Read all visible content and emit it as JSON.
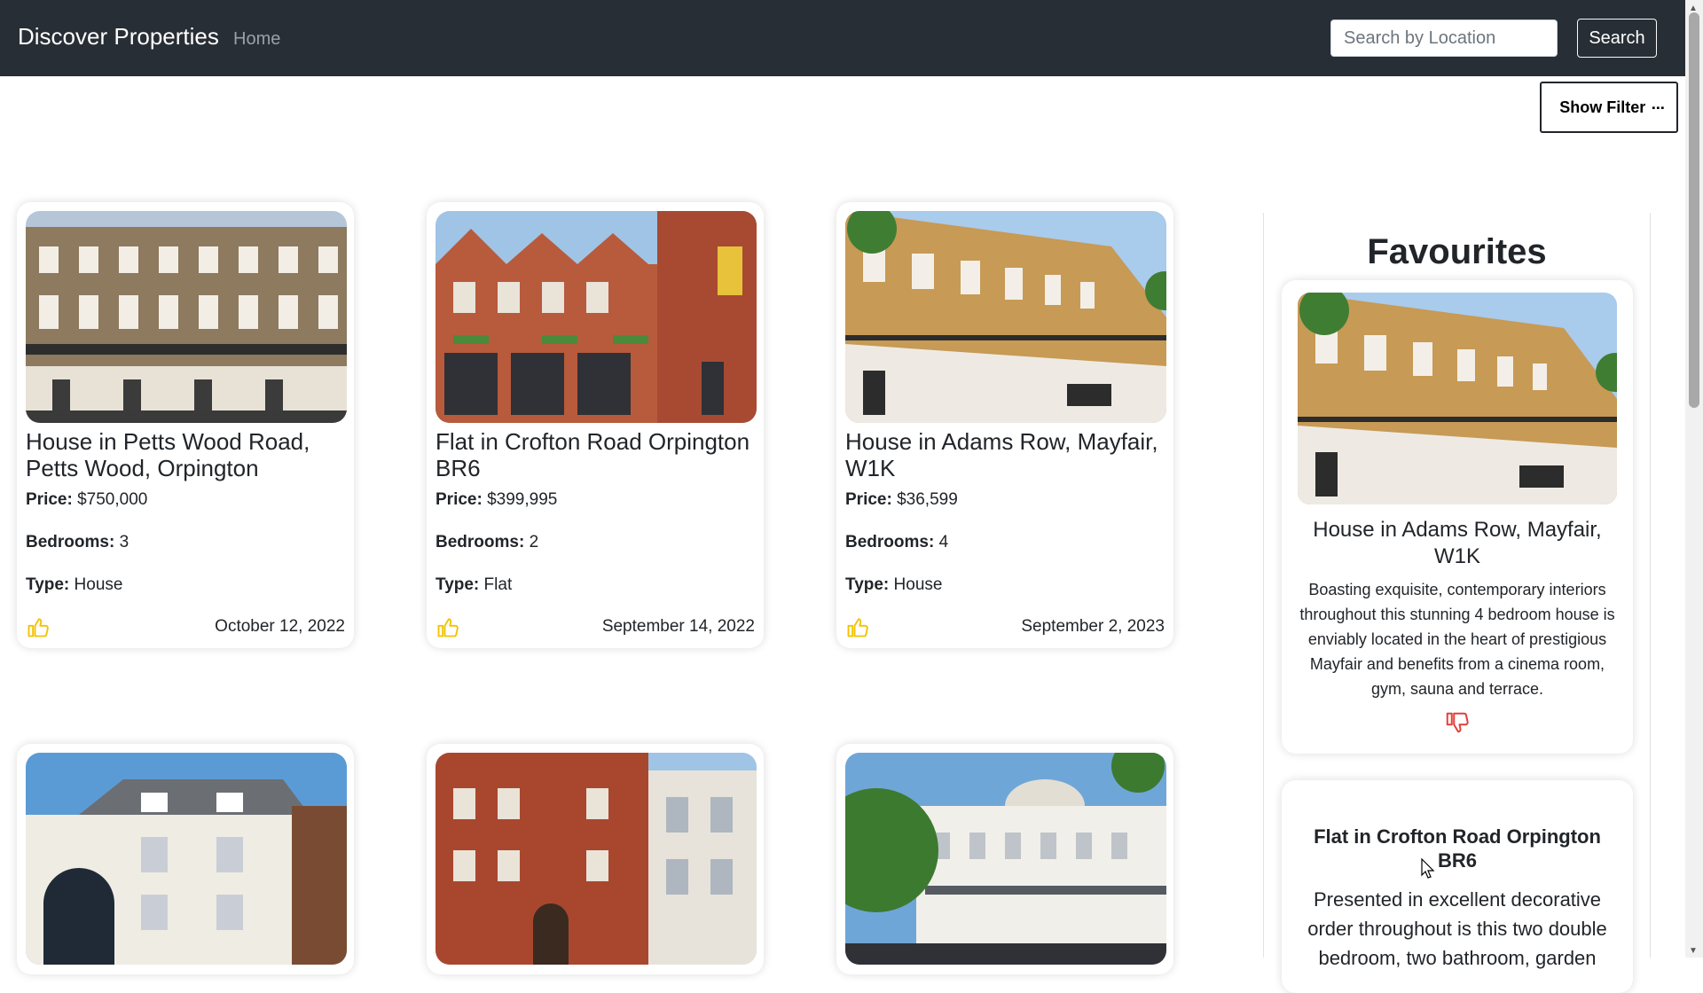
{
  "navbar": {
    "brand": "Discover Properties",
    "home": "Home",
    "search_placeholder": "Search by Location",
    "search_label": "Search"
  },
  "filter": {
    "label": "Show Filter",
    "icon": "sliders-icon"
  },
  "labels": {
    "price": "Price:",
    "bedrooms": "Bedrooms:",
    "type": "Type:"
  },
  "properties": [
    {
      "title": "House in Petts Wood Road, Petts Wood, Orpington",
      "price": "$750,000",
      "bedrooms": "3",
      "type": "House",
      "date": "October 12, 2022"
    },
    {
      "title": "Flat in Crofton Road Orpington BR6",
      "price": "$399,995",
      "bedrooms": "2",
      "type": "Flat",
      "date": "September 14, 2022"
    },
    {
      "title": "House in Adams Row, Mayfair, W1K",
      "price": "$36,599",
      "bedrooms": "4",
      "type": "House",
      "date": "September 2, 2023"
    },
    {
      "title": "",
      "price": "",
      "bedrooms": "",
      "type": "",
      "date": ""
    },
    {
      "title": "",
      "price": "",
      "bedrooms": "",
      "type": "",
      "date": ""
    },
    {
      "title": "",
      "price": "",
      "bedrooms": "",
      "type": "",
      "date": ""
    }
  ],
  "favourites": {
    "heading": "Favourites",
    "items": [
      {
        "title": "House in Adams Row, Mayfair, W1K",
        "description": "Boasting exquisite, contemporary interiors throughout this stunning 4 bedroom house is enviably located in the heart of prestigious Mayfair and benefits from a cinema room, gym, sauna and terrace."
      },
      {
        "title": "Flat in Crofton Road Orpington BR6",
        "description": "Presented in excellent decorative order throughout is this two double bedroom, two bathroom, garden"
      }
    ]
  },
  "colors": {
    "navbar_bg": "#282e35",
    "like_icon": "#f2c200",
    "dislike_icon": "#e0413c"
  }
}
